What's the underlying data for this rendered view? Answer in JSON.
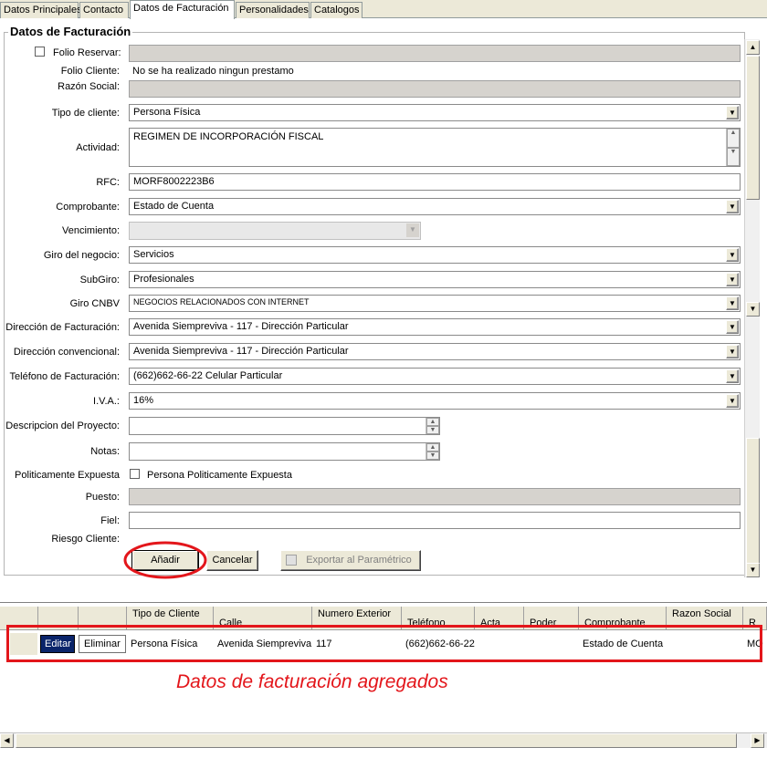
{
  "tabs": [
    "Datos Principales",
    "Contacto",
    "Datos de Facturación",
    "Personalidades",
    "Catalogos"
  ],
  "active_tab": 2,
  "group_title": "Datos de Facturación",
  "form": {
    "folio_reservar_label": "Folio Reservar:",
    "folio_cliente_label": "Folio Cliente:",
    "folio_cliente_value": "No se ha realizado ningun prestamo",
    "razon_social_label": "Razón Social:",
    "tipo_cliente_label": "Tipo de cliente:",
    "tipo_cliente_value": "Persona Física",
    "actividad_label": "Actividad:",
    "actividad_value": "REGIMEN DE INCORPORACIÓN FISCAL",
    "rfc_label": "RFC:",
    "rfc_value": "MORF8002223B6",
    "comprobante_label": "Comprobante:",
    "comprobante_value": "Estado de Cuenta",
    "vencimiento_label": "Vencimiento:",
    "giro_label": "Giro del negocio:",
    "giro_value": "Servicios",
    "subgiro_label": "SubGiro:",
    "subgiro_value": "Profesionales",
    "giro_cnbv_label": "Giro CNBV",
    "giro_cnbv_value": "NEGOCIOS RELACIONADOS CON INTERNET",
    "dir_fact_label": "Dirección de Facturación:",
    "dir_fact_value": "Avenida Siempreviva - 117 - Dirección Particular",
    "dir_conv_label": "Dirección convencional:",
    "dir_conv_value": "Avenida Siempreviva - 117 - Dirección Particular",
    "tel_label": "Teléfono de Facturación:",
    "tel_value": "(662)662-66-22 Celular Particular",
    "iva_label": "I.V.A.:",
    "iva_value": "16%",
    "desc_label": "Descripcion del Proyecto:",
    "notas_label": "Notas:",
    "pep_label": "Politicamente Expuesta",
    "pep_check_label": "Persona Politicamente Expuesta",
    "puesto_label": "Puesto:",
    "fiel_label": "Fiel:",
    "riesgo_label": "Riesgo Cliente:"
  },
  "buttons": {
    "anadir": "Añadir",
    "cancelar": "Cancelar",
    "exportar": "Exportar al Paramétrico"
  },
  "grid": {
    "headers": [
      "Tipo de Cliente",
      "Calle",
      "Numero Exterior",
      "Teléfono",
      "Acta",
      "Poder",
      "Comprobante",
      "Razon Social",
      "R"
    ],
    "row": {
      "editar": "Editar",
      "eliminar": "Eliminar",
      "tipo": "Persona Física",
      "calle": "Avenida Siempreviva",
      "numero": "117",
      "telefono": "(662)662-66-22",
      "acta": "",
      "poder": "",
      "comprobante": "Estado de Cuenta",
      "razon": "",
      "extra": "MO"
    }
  },
  "annotation": "Datos de facturación agregados",
  "colors": {
    "highlight_red": "#e3161b",
    "annotation_red": "#e3161b",
    "editar_bg": "#0a246a"
  }
}
